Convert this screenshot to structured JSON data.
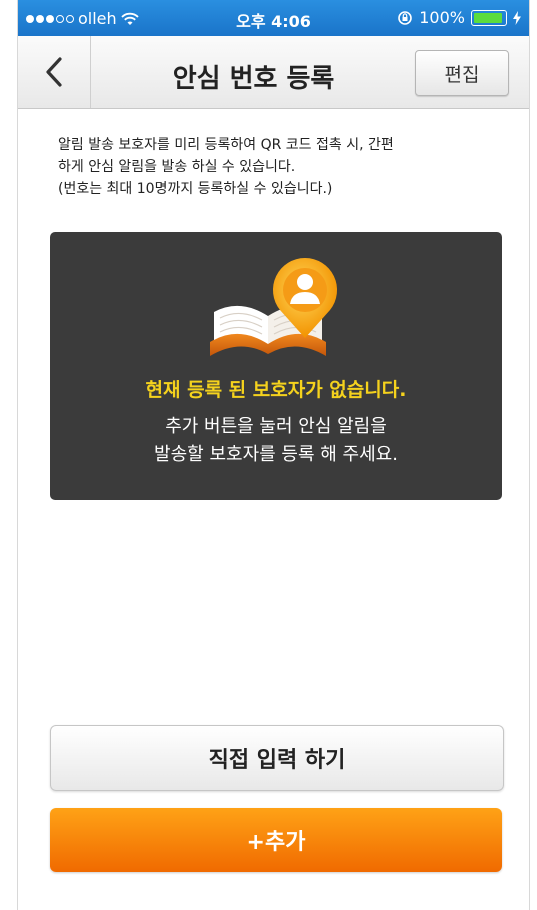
{
  "status_bar": {
    "carrier": "olleh",
    "time": "오후 4:06",
    "battery": "100%",
    "signal_filled": 3,
    "signal_total": 5
  },
  "nav": {
    "title": "안심 번호 등록",
    "edit_label": "편집"
  },
  "description": {
    "line1": "알림 발송 보호자를 미리 등록하여 QR 코드 접촉 시, 간편",
    "line2": "하게 안심 알림을 발송 하실 수 있습니다.",
    "line3": "(번호는 최대 10명까지 등록하실 수 있습니다.)"
  },
  "empty_state": {
    "title": "현재 등록 된 보호자가 없습니다.",
    "sub_line1": "추가 버튼을 눌러 안심 알림을",
    "sub_line2": "발송할 보호자를 등록 해 주세요."
  },
  "buttons": {
    "direct_input": "직접 입력 하기",
    "add": "+추가"
  },
  "colors": {
    "status_bar": "#1f80d6",
    "empty_box_bg": "#3b3b3b",
    "empty_title": "#f5d21d",
    "add_button": "#f58a0a"
  }
}
